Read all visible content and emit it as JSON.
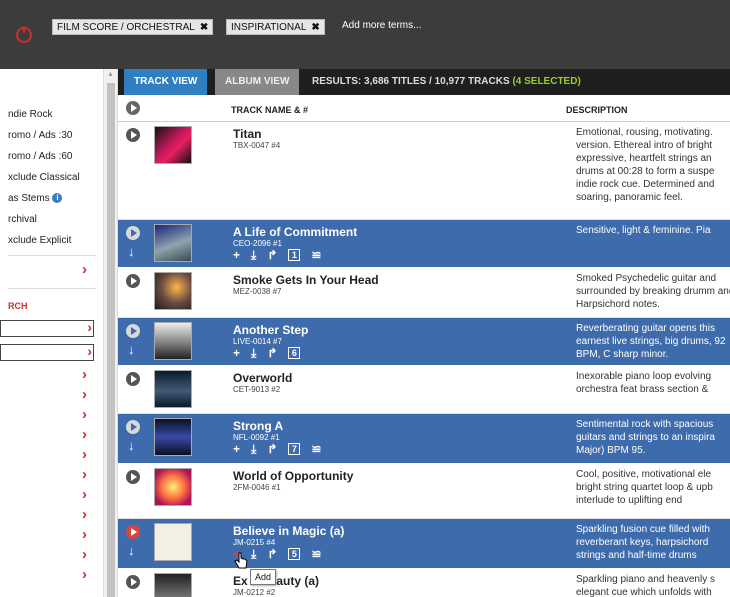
{
  "search": {
    "terms": [
      {
        "label": "FILM SCORE / ORCHESTRAL",
        "remove": "✖"
      },
      {
        "label": "INSPIRATIONAL",
        "remove": "✖"
      }
    ],
    "add_more": "Add more terms..."
  },
  "sidebar": {
    "items": [
      "ndie Rock",
      "romo / Ads :30",
      "romo / Ads :60",
      "xclude Classical",
      "as Stems",
      "rchival",
      "xclude Explicit"
    ],
    "section_heading": "RCH",
    "chevron": "›"
  },
  "tabs": {
    "track_view": "TRACK VIEW",
    "album_view": "ALBUM VIEW",
    "results_text": "RESULTS: 3,686 TITLES / 10,977 TRACKS",
    "selected_text": "(4 SELECTED)"
  },
  "columns": {
    "track_name": "TRACK NAME & #",
    "description": "DESCRIPTION"
  },
  "actions": {
    "add": "+",
    "download": "⤓",
    "share": "↱",
    "more": "≌"
  },
  "tracks": [
    {
      "title": "Titan",
      "code": "TBX-0047 #4",
      "desc": "Emotional, rousing, motivating. version. Ethereal intro of bright expressive, heartfelt strings an drums at 00:28 to form a suspe indie rock cue. Determined and soaring, panoramic feel.",
      "selected": false
    },
    {
      "title": "A Life of Commitment",
      "code": "CEO-2096 #1",
      "count": "1",
      "desc": "Sensitive, light & feminine. Pia",
      "selected": true
    },
    {
      "title": "Smoke Gets In Your Head",
      "code": "MEZ-0038 #7",
      "desc": "Smoked Psychedelic guitar and surrounded by breaking drumm and Harpsichord notes.",
      "selected": false
    },
    {
      "title": "Another Step",
      "code": "LIVE-0014 #7",
      "count": "6",
      "desc": "Reverberating guitar opens this earnest live strings, big drums, 92 BPM, C sharp minor.",
      "selected": true
    },
    {
      "title": "Overworld",
      "code": "CET-9013 #2",
      "desc": "Inexorable piano loop evolving orchestra feat brass section &",
      "selected": false
    },
    {
      "title": "Strong A",
      "code": "NFL-0092 #1",
      "count": "7",
      "desc": "Sentimental rock with spacious guitars and strings to an inspira Major) BPM 95.",
      "selected": true
    },
    {
      "title": "World of Opportunity",
      "code": "2FM-0046 #1",
      "desc": "Cool, positive, motivational ele bright string quartet loop & upb interlude to uplifting end",
      "selected": false
    },
    {
      "title": "Believe in Magic (a)",
      "code": "JM-0215 #4",
      "count": "5",
      "desc": "Sparkling fusion cue filled with reverberant keys, harpsichord strings and half-time drums",
      "selected": true
    },
    {
      "title": "Ex    e Beauty (a)",
      "code": "JM-0212 #2",
      "desc": "Sparkling piano and heavenly s elegant cue which unfolds with",
      "selected": false
    }
  ],
  "tooltip": "Add",
  "colors": {
    "header": "#3c3c3c",
    "tab_active": "#2f7fc1",
    "row_selected": "#3e6bab",
    "accent": "#c8312b",
    "selected_count": "#9acd32"
  }
}
